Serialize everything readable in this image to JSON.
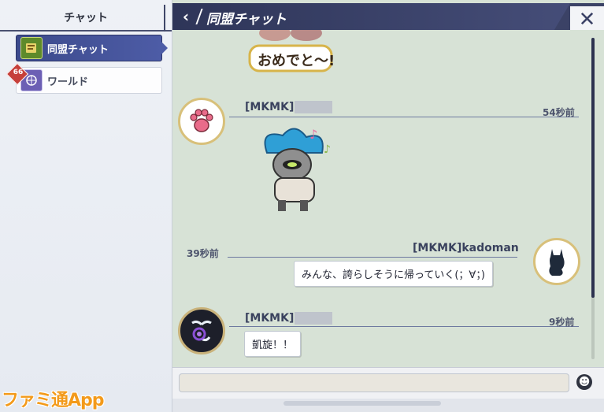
{
  "sidebar": {
    "header": "チャット",
    "items": [
      {
        "label": "同盟チャット",
        "icon": "book-icon",
        "active": true
      },
      {
        "label": "ワールド",
        "icon": "globe-emblem-icon",
        "badge": "66"
      }
    ]
  },
  "header": {
    "title": "同盟チャット",
    "back_icon": "chevron-left-icon",
    "close_label": "✕"
  },
  "messages": [
    {
      "type": "sticker",
      "text": "おめでと〜!"
    },
    {
      "user": "[MKMK]",
      "time": "54秒前",
      "side": "left",
      "avatar": "paw-icon",
      "type": "sticker"
    },
    {
      "user": "[MKMK]kadoman",
      "time": "39秒前",
      "side": "right",
      "avatar": "cat-icon",
      "text": "みんな、誇らしそうに帰っていく(；∀；)"
    },
    {
      "user": "[MKMK]",
      "time": "9秒前",
      "side": "left",
      "avatar": "crescent-swirl-icon",
      "text": "凱旋！！"
    }
  ],
  "input": {
    "placeholder": "",
    "emoji_icon": "smiley-icon"
  },
  "watermark": "ファミ通App",
  "colors": {
    "accent": "#3b4266",
    "chat_bg": "#d7e2d6",
    "sidebar_active": "#4d5ca6"
  }
}
